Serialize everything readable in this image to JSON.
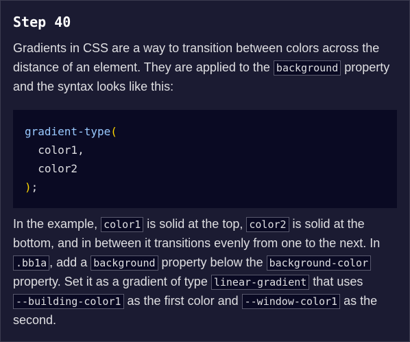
{
  "step": {
    "title": "Step 40"
  },
  "paragraph1": {
    "text_a": "Gradients in CSS are a way to transition between colors across the distance of an element. They are applied to the ",
    "code_a": "background",
    "text_b": " property and the syntax looks like this:"
  },
  "code_example": {
    "fn_name": "gradient-type",
    "open_paren": "(",
    "indent": "  ",
    "arg1": "color1",
    "comma": ",",
    "arg2": "color2",
    "close_paren": ")",
    "semicolon": ";"
  },
  "paragraph2": {
    "text_a": "In the example, ",
    "code_a": "color1",
    "text_b": " is solid at the top, ",
    "code_b": "color2",
    "text_c": " is solid at the bottom, and in between it transitions evenly from one to the next. In ",
    "code_c": ".bb1a",
    "text_d": ", add a ",
    "code_d": "background",
    "text_e": " property below the ",
    "code_e": "background-color",
    "text_f": " property. Set it as a gradient of type ",
    "code_f": "linear-gradient",
    "text_g": " that uses ",
    "code_g": "--building-color1",
    "text_h": " as the first color and ",
    "code_h": "--window-color1",
    "text_i": " as the second."
  },
  "colors": {
    "background": "#1b1b32",
    "code_background": "#0a0a23",
    "text": "#dfdfe2",
    "function_name": "#99c9ff",
    "parenthesis": "#ffd700"
  }
}
